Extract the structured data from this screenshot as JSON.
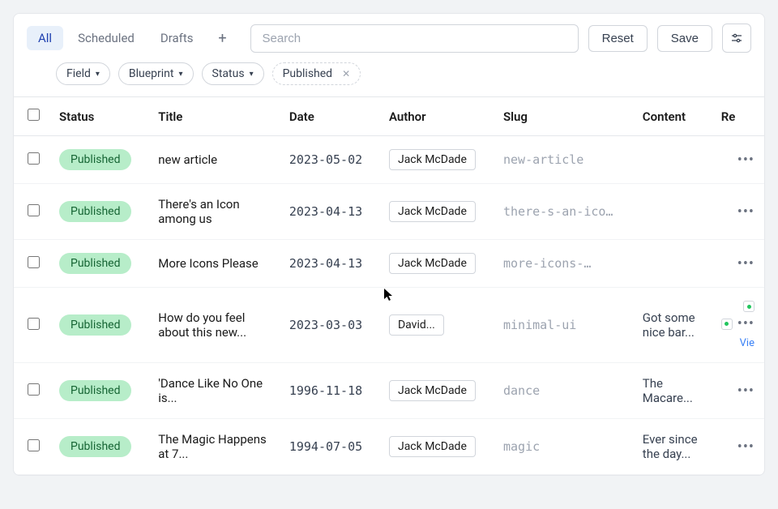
{
  "toolbar": {
    "tabs": {
      "all": "All",
      "scheduled": "Scheduled",
      "drafts": "Drafts"
    },
    "search_placeholder": "Search",
    "reset": "Reset",
    "save": "Save"
  },
  "filters": {
    "field": "Field",
    "blueprint": "Blueprint",
    "status": "Status",
    "active": "Published"
  },
  "columns": {
    "status": "Status",
    "title": "Title",
    "date": "Date",
    "author": "Author",
    "slug": "Slug",
    "content": "Content",
    "rev": "Re"
  },
  "status_label": "Published",
  "view_label": "Vie",
  "rows": [
    {
      "title": "new article",
      "date": "2023-05-02",
      "author": "Jack McDade",
      "slug": "new-article",
      "content": "",
      "rev": false
    },
    {
      "title": "There's an Icon among us",
      "date": "2023-04-13",
      "author": "Jack McDade",
      "slug": "there-s-an-ico…",
      "content": "",
      "rev": false
    },
    {
      "title": "More Icons Please",
      "date": "2023-04-13",
      "author": "Jack McDade",
      "slug": "more-icons-…",
      "content": "",
      "rev": false
    },
    {
      "title": "How do you feel about this new...",
      "date": "2023-03-03",
      "author": "David...",
      "slug": "minimal-ui",
      "content": "Got some nice bar...",
      "rev": true
    },
    {
      "title": "'Dance Like No One is...",
      "date": "1996-11-18",
      "author": "Jack McDade",
      "slug": "dance",
      "content": "The Macare...",
      "rev": false
    },
    {
      "title": "The Magic Happens at 7...",
      "date": "1994-07-05",
      "author": "Jack McDade",
      "slug": "magic",
      "content": "Ever since the day...",
      "rev": false
    }
  ]
}
